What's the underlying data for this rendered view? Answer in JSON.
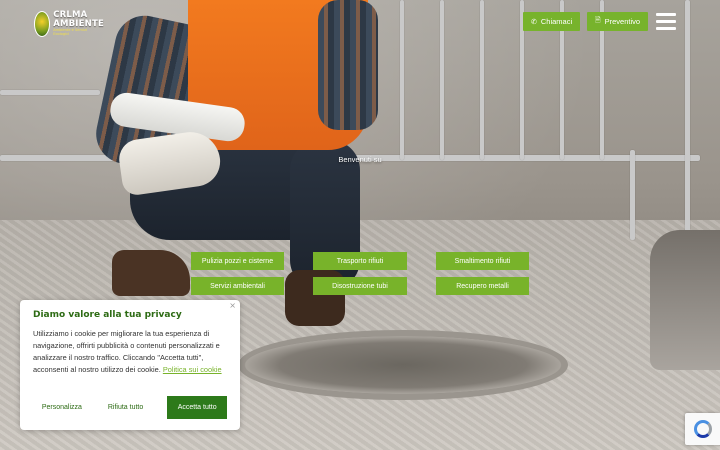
{
  "header": {
    "logo": {
      "name_line1": "CRLMA",
      "name_line2": "AMBIENTE",
      "tagline": "Ambiente e Servizi Ecologici"
    },
    "call_button": {
      "label": "Chiamaci",
      "icon": "phone-icon"
    },
    "quote_button": {
      "label": "Preventivo",
      "icon": "document-icon"
    },
    "menu_icon": "hamburger-menu-icon"
  },
  "hero": {
    "welcome": "Benvenuti su"
  },
  "services": [
    "Pulizia pozzi e cisterne",
    "Trasporto rifiuti",
    "Smaltimento rifiuti",
    "Servizi ambientali",
    "Disostruzione tubi",
    "Recupero metalli"
  ],
  "cookie_banner": {
    "close": "×",
    "title": "Diamo valore alla tua privacy",
    "body": "Utilizziamo i cookie per migliorare la tua esperienza di navigazione, offrirti pubblicità o contenuti personalizzati e analizzare il nostro traffico. Cliccando \"Accetta tutti\", acconsenti al nostro utilizzo dei cookie.",
    "policy_link": "Politica sui cookie",
    "customize": "Personalizza",
    "reject": "Rifiuta tutto",
    "accept": "Accetta tutto"
  },
  "colors": {
    "brand_green": "#78b32a",
    "dark_green": "#2d7a1a",
    "title_green": "#2d6b14",
    "vest_orange": "#f27a1f"
  },
  "recaptcha_icon": "recaptcha-icon"
}
